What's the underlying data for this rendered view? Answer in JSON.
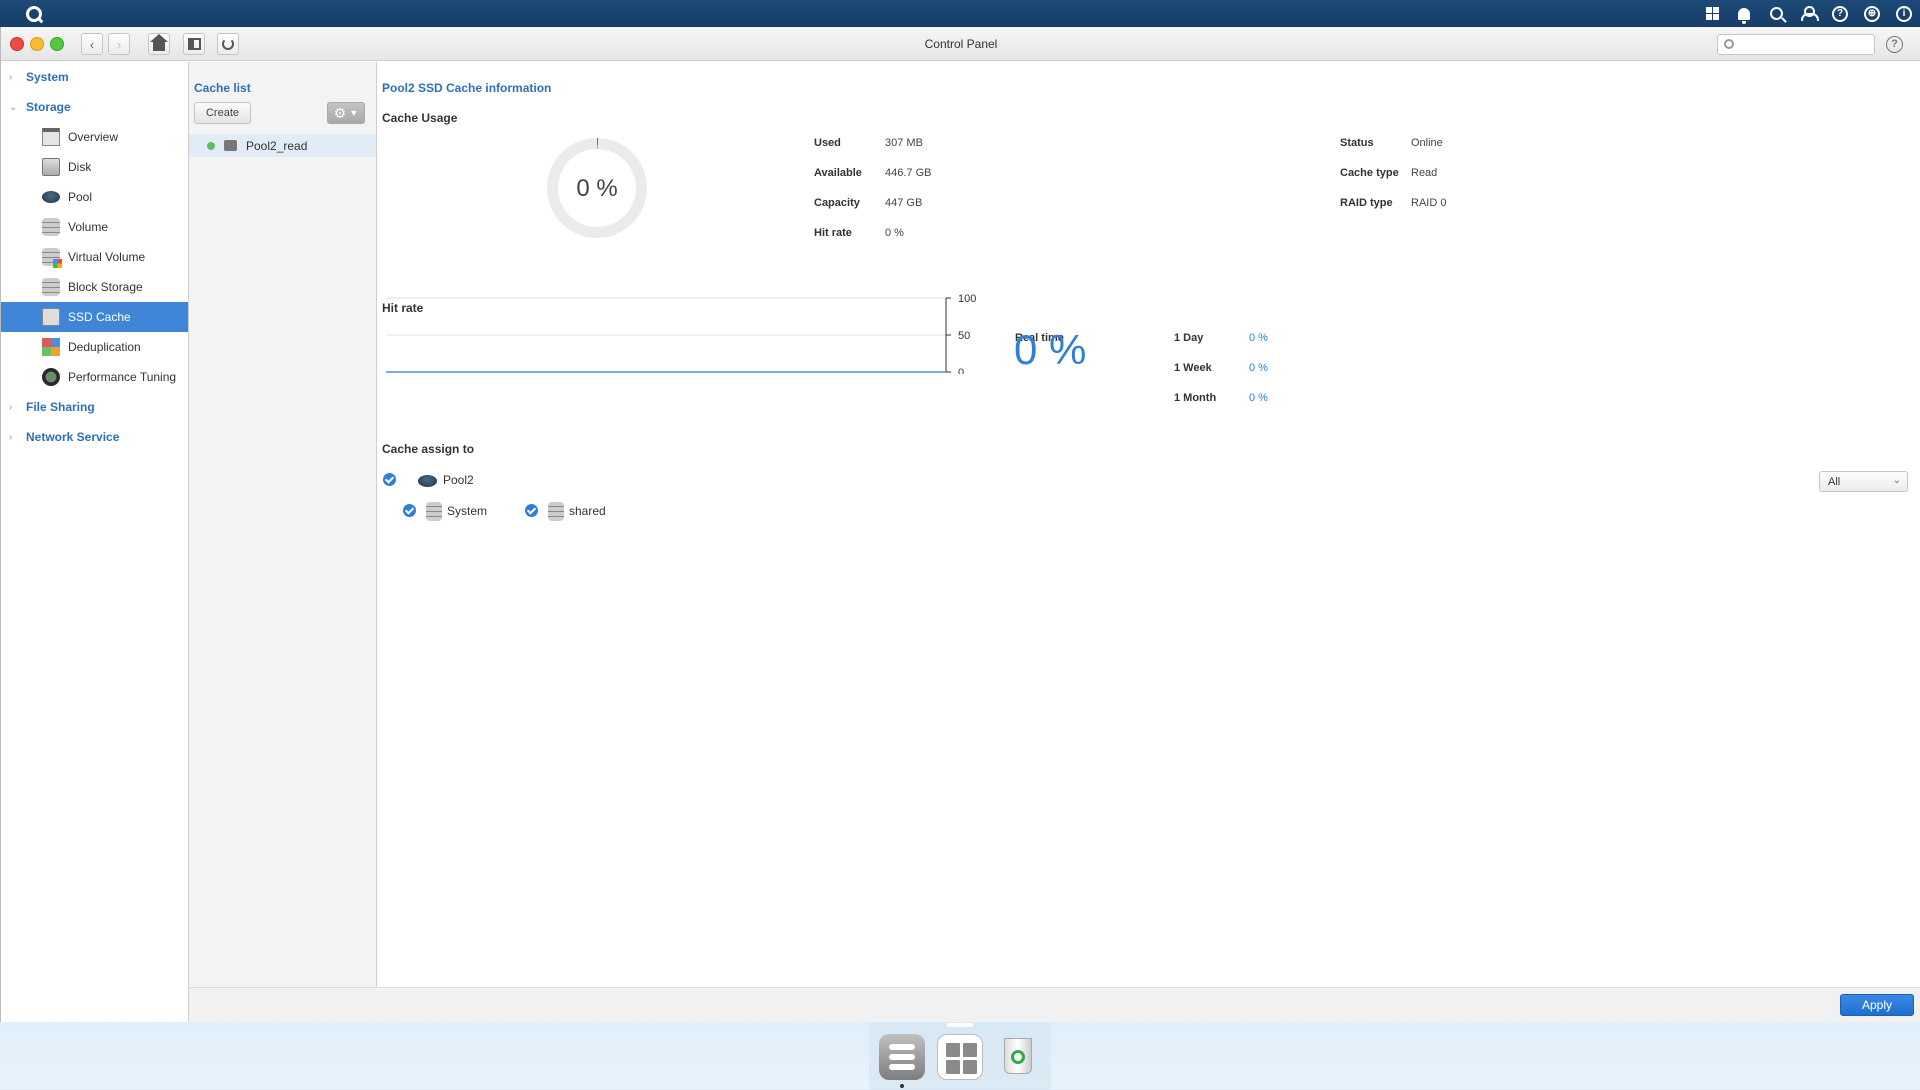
{
  "topbar": {
    "icons": [
      "logo-icon",
      "apps-grid-icon",
      "notification-bell-icon",
      "search-icon",
      "user-icon",
      "help-icon",
      "globe-icon",
      "dashboard-icon"
    ]
  },
  "window": {
    "title": "Control Panel",
    "search_placeholder": "",
    "help_label": "?"
  },
  "sidebar": {
    "sections": {
      "system": "System",
      "storage": "Storage",
      "file_sharing": "File Sharing",
      "network_service": "Network Service"
    },
    "items": [
      {
        "label": "Overview",
        "icon": "overview-icon"
      },
      {
        "label": "Disk",
        "icon": "disk-icon"
      },
      {
        "label": "Pool",
        "icon": "pool-icon"
      },
      {
        "label": "Volume",
        "icon": "volume-icon"
      },
      {
        "label": "Virtual Volume",
        "icon": "virtual-volume-icon"
      },
      {
        "label": "Block Storage",
        "icon": "block-storage-icon"
      },
      {
        "label": "SSD Cache",
        "icon": "ssd-cache-icon",
        "active": true
      },
      {
        "label": "Deduplication",
        "icon": "deduplication-icon"
      },
      {
        "label": "Performance Tuning",
        "icon": "performance-tuning-icon"
      }
    ]
  },
  "cache_list": {
    "title": "Cache list",
    "create_label": "Create",
    "items": [
      {
        "name": "Pool2_read",
        "status_color": "#5cc05c"
      }
    ]
  },
  "main": {
    "title": "Pool2 SSD Cache information",
    "cache_usage": {
      "title": "Cache Usage",
      "percent": "0 %",
      "fields": [
        {
          "key": "Used",
          "value": "307 MB"
        },
        {
          "key": "Available",
          "value": "446.7 GB"
        },
        {
          "key": "Capacity",
          "value": "447 GB"
        },
        {
          "key": "Hit rate",
          "value": "0 %"
        }
      ],
      "fields_right": [
        {
          "key": "Status",
          "value": "Online"
        },
        {
          "key": "Cache type",
          "value": "Read"
        },
        {
          "key": "RAID type",
          "value": "RAID 0"
        }
      ]
    },
    "hit_rate": {
      "title": "Hit rate",
      "realtime_label": "Real time",
      "realtime_value": "0 %",
      "periods": [
        {
          "key": "1 Day",
          "value": "0 %"
        },
        {
          "key": "1 Week",
          "value": "0 %"
        },
        {
          "key": "1 Month",
          "value": "0 %"
        }
      ]
    },
    "assign": {
      "title": "Cache assign to",
      "pool": "Pool2",
      "volumes": [
        "System",
        "shared"
      ],
      "filter_value": "All"
    }
  },
  "footer": {
    "apply_label": "Apply"
  },
  "chart_data": {
    "type": "line",
    "title": "",
    "xlabel": "",
    "ylabel": "",
    "yticks": [
      "100",
      "50",
      "0"
    ],
    "ylim": [
      0,
      100
    ],
    "series": [
      {
        "values": [
          0,
          0,
          0,
          0,
          0,
          0,
          0,
          0,
          0,
          0
        ]
      }
    ],
    "grid": true,
    "line_color": "#4a90e2"
  },
  "colors": {
    "accent": "#2f7fd8",
    "sidebar_active": "#3f86d9",
    "section_title": "#2f6fb8",
    "status_online": "#5cc05c"
  }
}
